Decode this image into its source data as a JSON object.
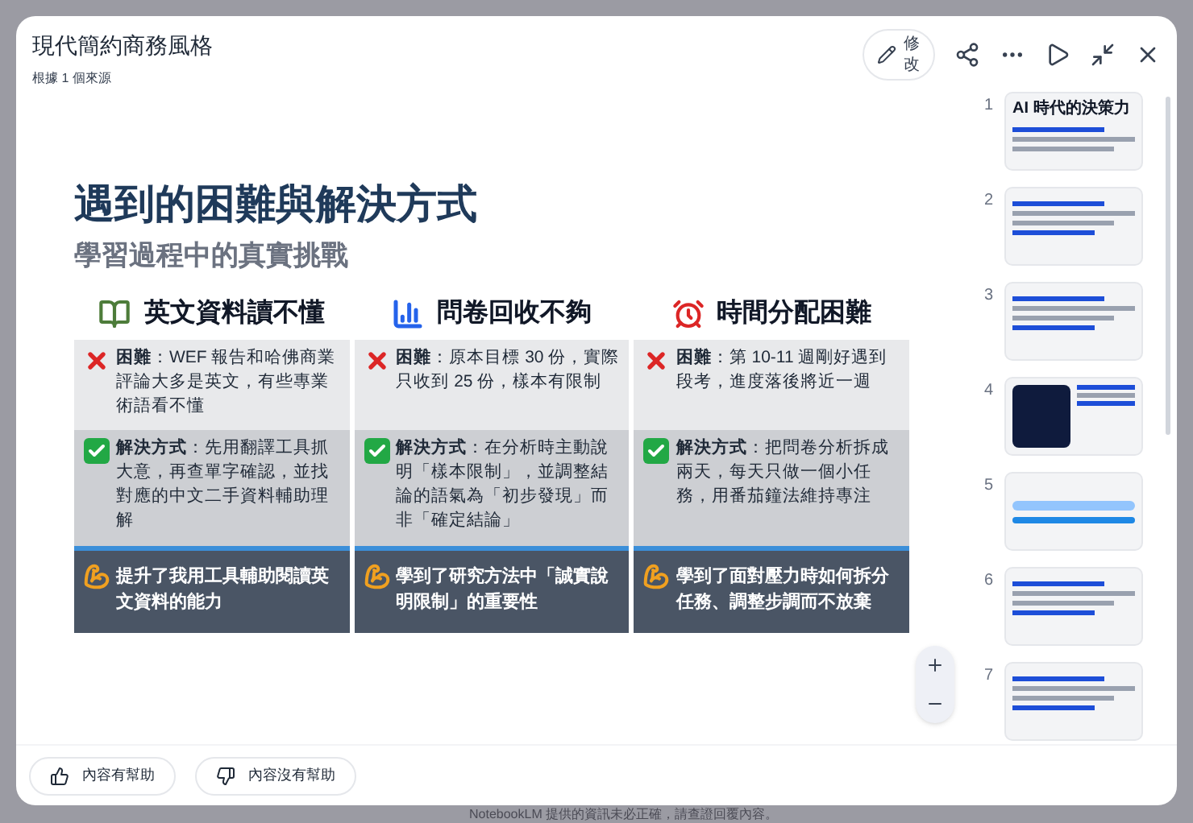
{
  "dialog": {
    "title": "現代簡約商務風格",
    "subtitle": "根據 1 個來源",
    "edit_button": "修改"
  },
  "slide": {
    "title": "遇到的困難與解決方式",
    "subtitle": "學習過程中的真實挑戰",
    "columns": [
      {
        "heading": "英文資料讀不懂",
        "difficulty": "**困難**：WEF 報告和哈佛商業評論大多是英文，有些專業術語看不懂",
        "solution": "**解決方式**：先用翻譯工具抓大意，再查單字確認，並找對應的中文二手資料輔助理解",
        "outcome": "提升了我用工具輔助閱讀英文資料的能力"
      },
      {
        "heading": "問卷回收不夠",
        "difficulty": "**困難**：原本目標 30 份，實際只收到 25 份，樣本有限制",
        "solution": "**解決方式**：在分析時主動說明「樣本限制」，並調整結論的語氣為「初步發現」而非「確定結論」",
        "outcome": "學到了研究方法中「誠實說明限制」的重要性"
      },
      {
        "heading": "時間分配困難",
        "difficulty": "**困難**：第 10-11 週剛好遇到段考，進度落後將近一週",
        "solution": "**解決方式**：把問卷分析拆成兩天，每天只做一個小任務，用番茄鐘法維持專注",
        "outcome": "學到了面對壓力時如何拆分任務、調整步調而不放棄"
      }
    ]
  },
  "thumbnails": [
    {
      "number": "1",
      "title": "AI 時代的決策力",
      "selected": false
    },
    {
      "number": "2",
      "selected": false
    },
    {
      "number": "3",
      "selected": false
    },
    {
      "number": "4",
      "selected": false
    },
    {
      "number": "5",
      "selected": false
    },
    {
      "number": "6",
      "selected": false
    },
    {
      "number": "7",
      "selected": false
    }
  ],
  "feedback_buttons": [
    "內容有幫助",
    "內容沒有幫助"
  ],
  "disclaimer": "NotebookLM 提供的資訊未必正確，請查證回覆內容。"
}
